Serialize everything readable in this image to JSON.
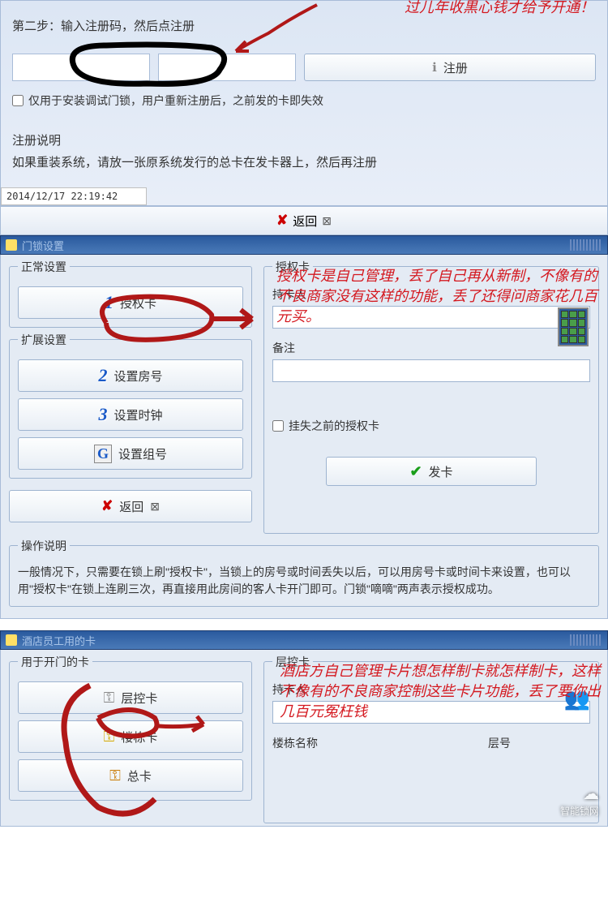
{
  "panel1": {
    "step_text": "第二步：输入注册码，然后点注册",
    "register_btn": "注册",
    "checkbox_label": "仅用于安装调试门锁，用户重新注册后，之前发的卡即失效",
    "desc_title": "注册说明",
    "desc_text": "如果重装系统，请放一张原系统发行的总卡在发卡器上，然后再注册",
    "timestamp": "2014/12/17 22:19:42",
    "back_btn": "返回"
  },
  "annotation1": "过儿年收黒心钱才给予开通！",
  "win2": {
    "title": "门锁设置",
    "normal_title": "正常设置",
    "btn_auth": "授权卡",
    "ext_title": "扩展设置",
    "btn_room": "设置房号",
    "btn_clock": "设置时钟",
    "btn_group": "设置组号",
    "back_btn": "返回",
    "auth_panel_title": "授权卡",
    "holder_label": "持卡人",
    "remark_label": "备注",
    "lost_chk": "挂失之前的授权卡",
    "issue_btn": "发卡",
    "op_title": "操作说明",
    "op_text": "一般情况下，只需要在锁上刷\"授权卡\"，当锁上的房号或时间丢失以后，可以用房号卡或时间卡来设置，也可以用\"授权卡\"在锁上连刷三次，再直接用此房间的客人卡开门即可。门锁\"嘀嘀\"两声表示授权成功。"
  },
  "annotation2": "授权卡是自己管理，丢了自己再从新制，不像有的不良商家没有这样的功能，丢了还得问商家花几百元买。",
  "win3": {
    "title": "酒店员工用的卡",
    "open_title": "用于开门的卡",
    "btn_floor": "层控卡",
    "btn_building": "楼栋卡",
    "btn_master": "总卡",
    "floor_panel_title": "层控卡",
    "holder_label": "持卡人",
    "building_label": "楼栋名称",
    "floor_label": "层号"
  },
  "annotation3": "酒店方自己管理卡片想怎样制卡就怎样制卡，这样不像有的不良商家控制这些卡片功能，丢了要你出几百元冤枉钱",
  "watermark": "智能锁网"
}
